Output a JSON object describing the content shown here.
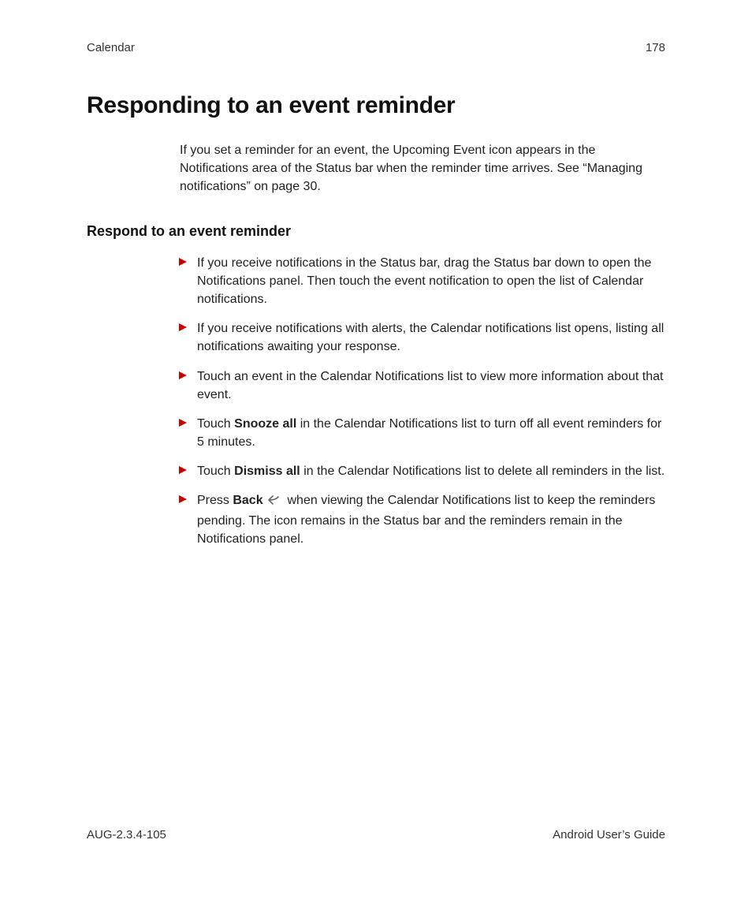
{
  "header": {
    "section": "Calendar",
    "page": "178"
  },
  "title": "Responding to an event reminder",
  "intro": "If you set a reminder for an event, the Upcoming Event icon appears in the Notifications area of the Status bar when the reminder time arrives. See “Managing notifications” on page 30.",
  "subhead": "Respond to an event reminder",
  "bullets": {
    "b0": "If you receive notifications in the Status bar, drag the Status bar down to open the Notifications panel. Then touch the event notification to open the list of Calendar notifications.",
    "b1": "If you receive notifications with alerts, the Calendar notifications list opens, listing all notifications awaiting your response.",
    "b2": "Touch an event in the Calendar Notifications list to view more information about that event.",
    "b3_pre": "Touch ",
    "b3_bold": "Snooze all",
    "b3_post": " in the Calendar Notifications list to turn off all event reminders for 5 minutes.",
    "b4_pre": "Touch ",
    "b4_bold": "Dismiss all",
    "b4_post": " in the Calendar Notifications list to delete all reminders in the list.",
    "b5_pre": "Press ",
    "b5_bold": "Back",
    "b5_post": " when viewing the Calendar Notifications list to keep the reminders pending. The icon remains in the Status bar and the reminders remain in the Notifications panel."
  },
  "footer": {
    "doc_id": "AUG-2.3.4-105",
    "doc_title": "Android User’s Guide"
  }
}
